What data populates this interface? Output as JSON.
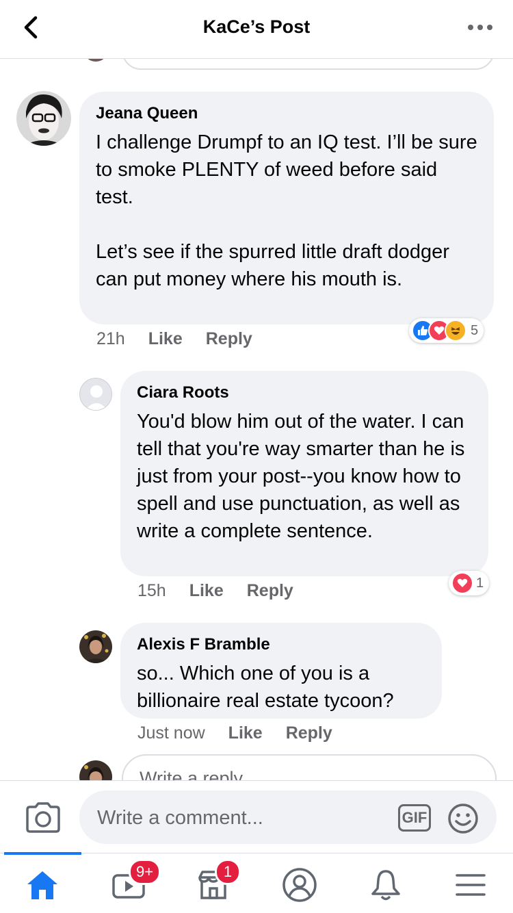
{
  "header": {
    "title": "KaCe’s Post"
  },
  "comments": [
    {
      "author": "Jeana Queen",
      "text": "I challenge Drumpf to an IQ test. I’ll be sure to smoke PLENTY of weed before said test.\n\nLet’s see if the spurred little draft dodger can put money where his mouth is.",
      "time": "21h",
      "like_label": "Like",
      "reply_label": "Reply",
      "reaction_icons": [
        "like-icon",
        "love-icon",
        "haha-icon"
      ],
      "reaction_count": "5"
    },
    {
      "author": "Ciara Roots",
      "text": "You'd blow him out of the water.  I can tell that you're way smarter than he is just from your post--you know how to spell and use punctuation, as well as write a complete sentence.",
      "time": "15h",
      "like_label": "Like",
      "reply_label": "Reply",
      "reaction_icons": [
        "love-icon"
      ],
      "reaction_count": "1"
    },
    {
      "author": "Alexis F Bramble",
      "text": "so... Which one of you is a billionaire real estate tycoon?",
      "time": "Just now",
      "like_label": "Like",
      "reply_label": "Reply"
    }
  ],
  "reply_box": {
    "placeholder": "Write a reply..."
  },
  "composer": {
    "placeholder": "Write a comment...",
    "gif_label": "GIF"
  },
  "tabbar": {
    "watch_badge": "9+",
    "marketplace_badge": "1"
  },
  "colors": {
    "accent": "#1877f2",
    "badge": "#e41e3f",
    "bubble": "#f0f2f5",
    "secondary_text": "#65676b"
  }
}
